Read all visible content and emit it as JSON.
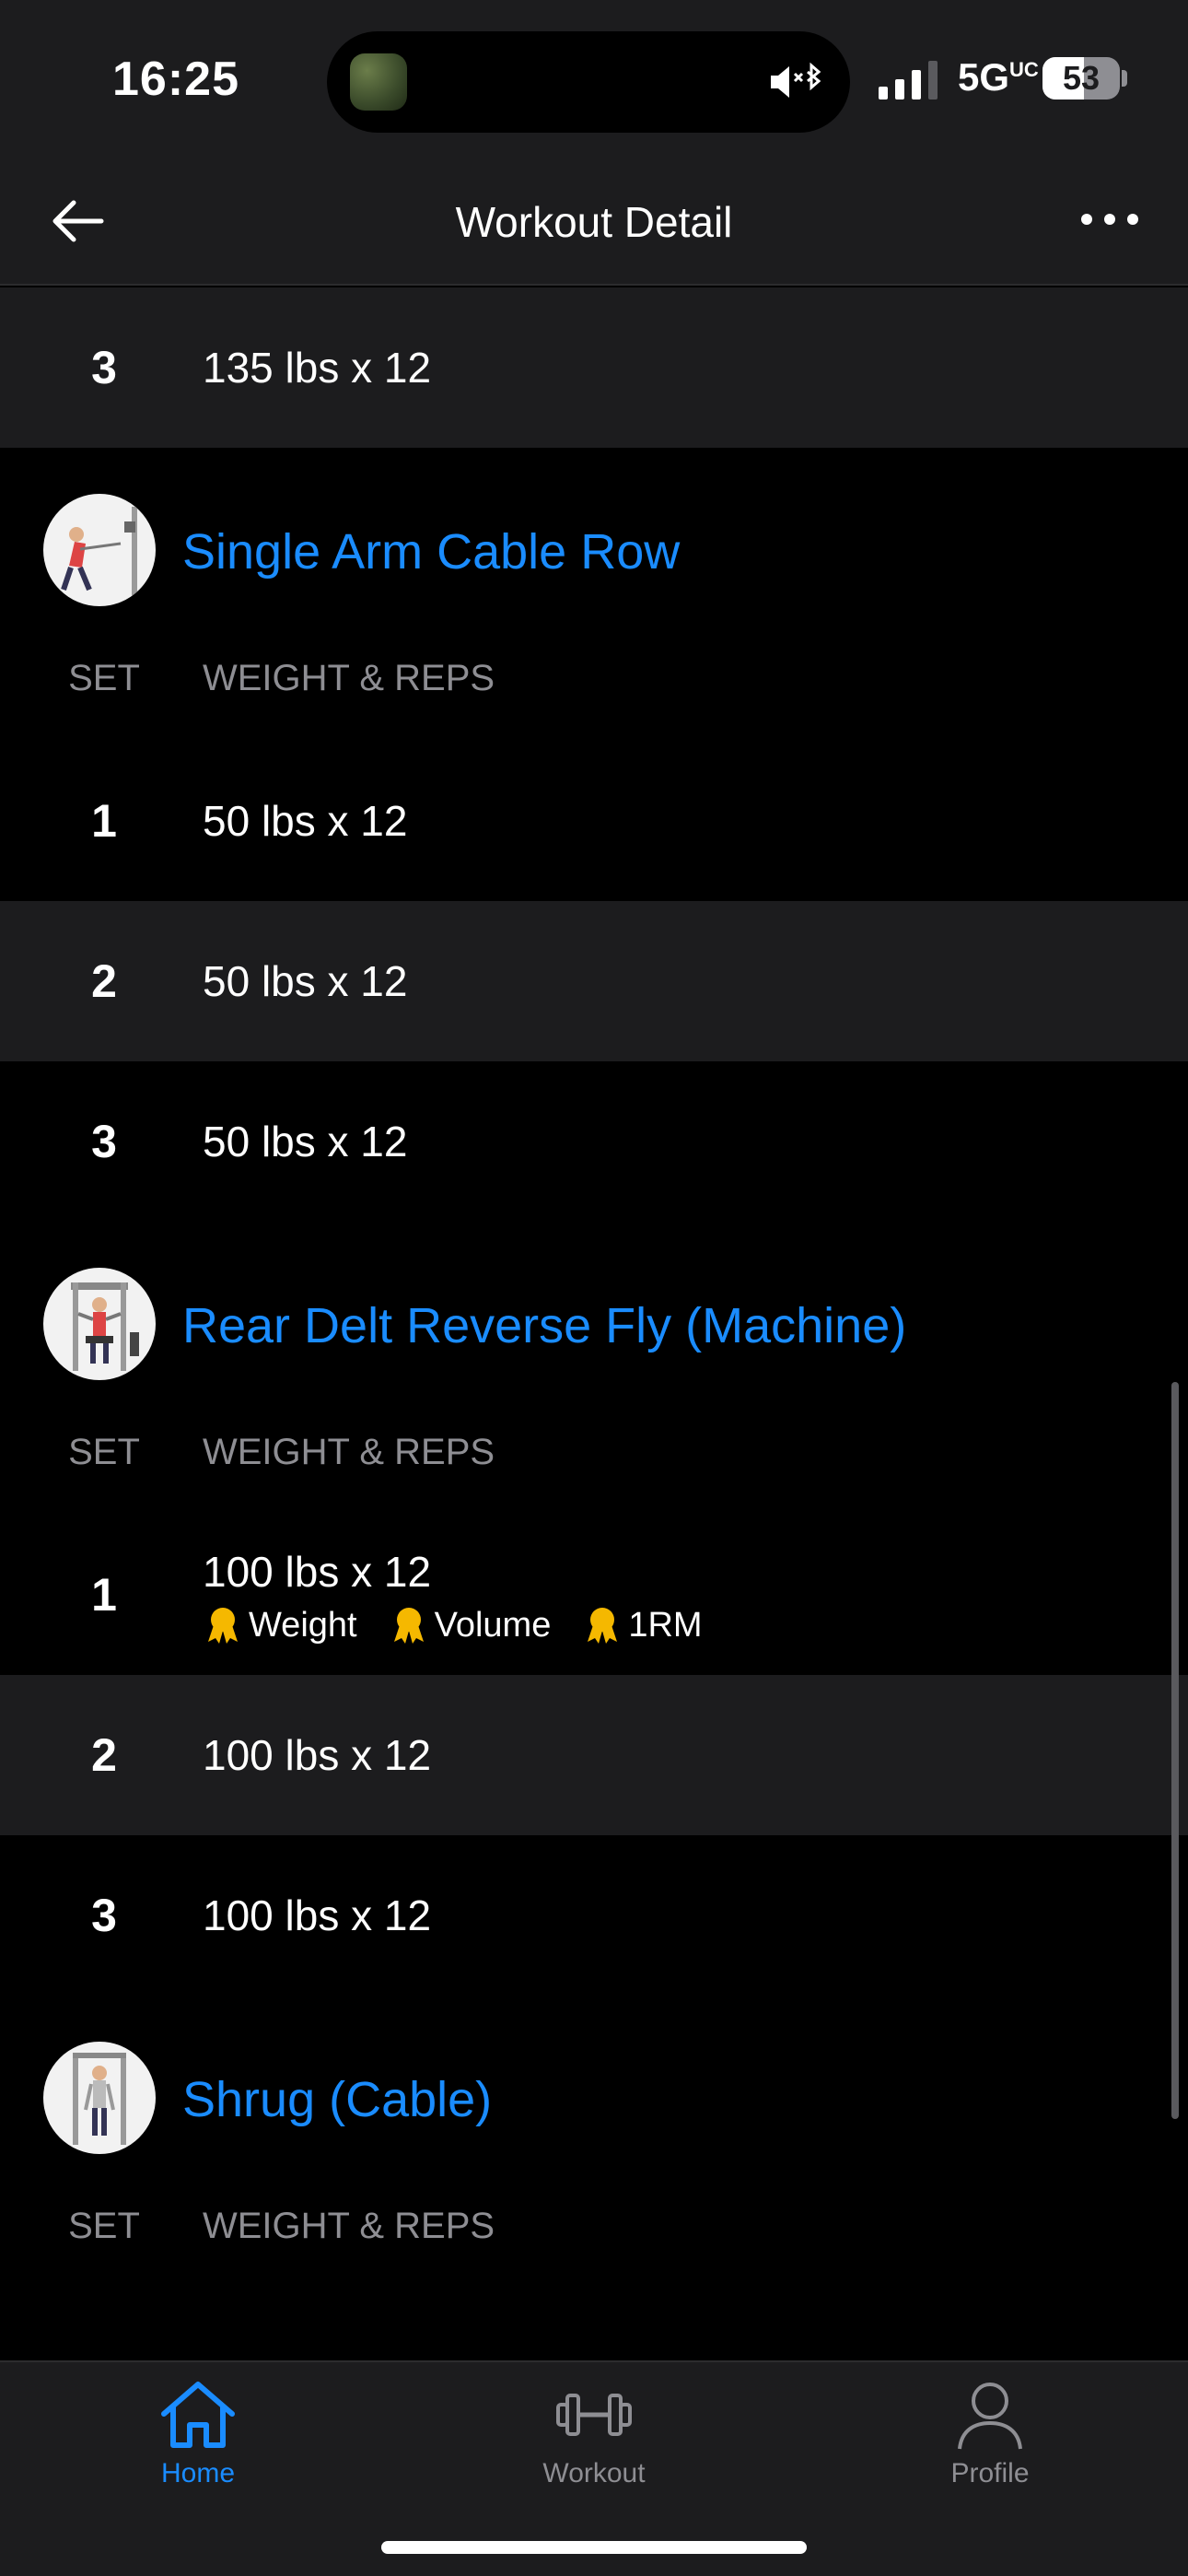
{
  "status_bar": {
    "time": "16:25",
    "network": "5G",
    "network_suffix": "UC",
    "battery": "53",
    "battery_level": 0.53
  },
  "nav": {
    "title": "Workout Detail",
    "back_icon": "arrow-left-icon",
    "more_icon": "ellipsis-icon"
  },
  "prev_exercise": {
    "rows": [
      {
        "set": "3",
        "value": "135 lbs x 12"
      }
    ]
  },
  "columns": {
    "set": "SET",
    "weight_reps": "WEIGHT & REPS"
  },
  "exercises": [
    {
      "name": "Single Arm Cable Row",
      "rows": [
        {
          "set": "1",
          "value": "50 lbs x 12"
        },
        {
          "set": "2",
          "value": "50 lbs x 12"
        },
        {
          "set": "3",
          "value": "50 lbs x 12"
        }
      ]
    },
    {
      "name": "Rear Delt Reverse Fly (Machine)",
      "rows": [
        {
          "set": "1",
          "value": "100 lbs x 12",
          "badges": [
            "Weight",
            "Volume",
            "1RM"
          ]
        },
        {
          "set": "2",
          "value": "100 lbs x 12"
        },
        {
          "set": "3",
          "value": "100 lbs x 12"
        }
      ]
    },
    {
      "name": "Shrug (Cable)",
      "rows": []
    }
  ],
  "tabs": [
    {
      "label": "Home",
      "icon": "home-icon",
      "active": true
    },
    {
      "label": "Workout",
      "icon": "dumbbell-icon",
      "active": false
    },
    {
      "label": "Profile",
      "icon": "person-icon",
      "active": false
    }
  ],
  "colors": {
    "accent": "#1a8cff",
    "row_alt": "#1c1c1e",
    "background": "#000000",
    "medal": "#f5b800"
  }
}
